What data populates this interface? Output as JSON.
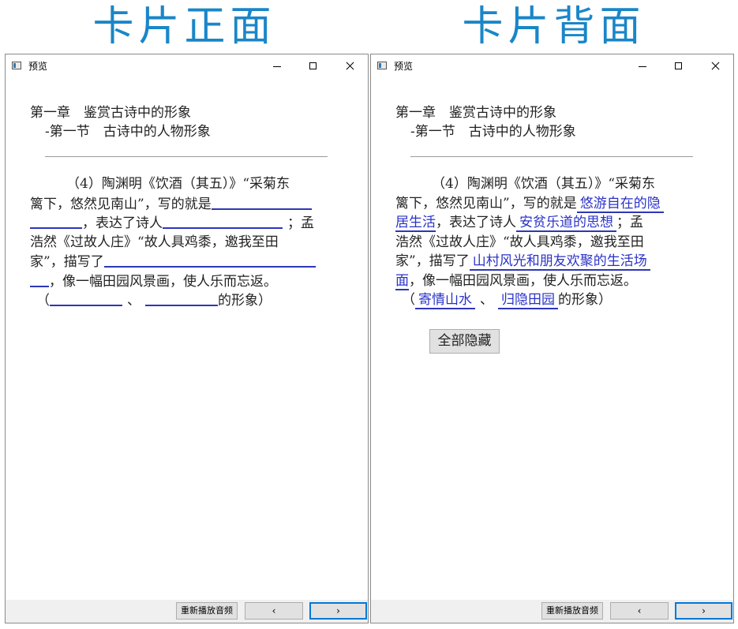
{
  "headers": {
    "front": "卡片正面",
    "back": "卡片背面"
  },
  "window": {
    "title": "预览",
    "icon": "app-window-icon"
  },
  "content": {
    "chapter": "第一章　鉴赏古诗中的形象",
    "section": "-第一节　古诗中的人物形象",
    "q_line1": "（4）陶渊明《饮酒（其五）》“采菊东",
    "q_line2_prefix": "篱下，悠然见南山”，写的就是",
    "q_line3_mid": "，表达了诗人",
    "q_line3_end": "；孟",
    "q_line4": "浩然《过故人庄》“故人具鸡黍，邀我至田",
    "q_line5_prefix": "家”，描写了",
    "q_line6_suffix": "，像一幅田园风景画，使人乐而忘返。",
    "q_line7_open": "（",
    "q_line7_sep": "、",
    "q_line7_close": "的形象）"
  },
  "answers": {
    "a1_part1": "悠游自在的隐",
    "a1_part2": "居生活",
    "a2": "安贫乐道的思想",
    "a3_part1": "山村风光和朋友欢聚的生活场",
    "a3_part2": "面",
    "a4": "寄情山水",
    "a5": "归隐田园"
  },
  "buttons": {
    "hide_all": "全部隐藏",
    "replay_audio": "重新播放音频",
    "prev": "‹",
    "next": "›"
  },
  "colors": {
    "header": "#1a86c8",
    "answer": "#2a32c8",
    "underline": "#2d36b8",
    "focus_border": "#0078d7"
  }
}
